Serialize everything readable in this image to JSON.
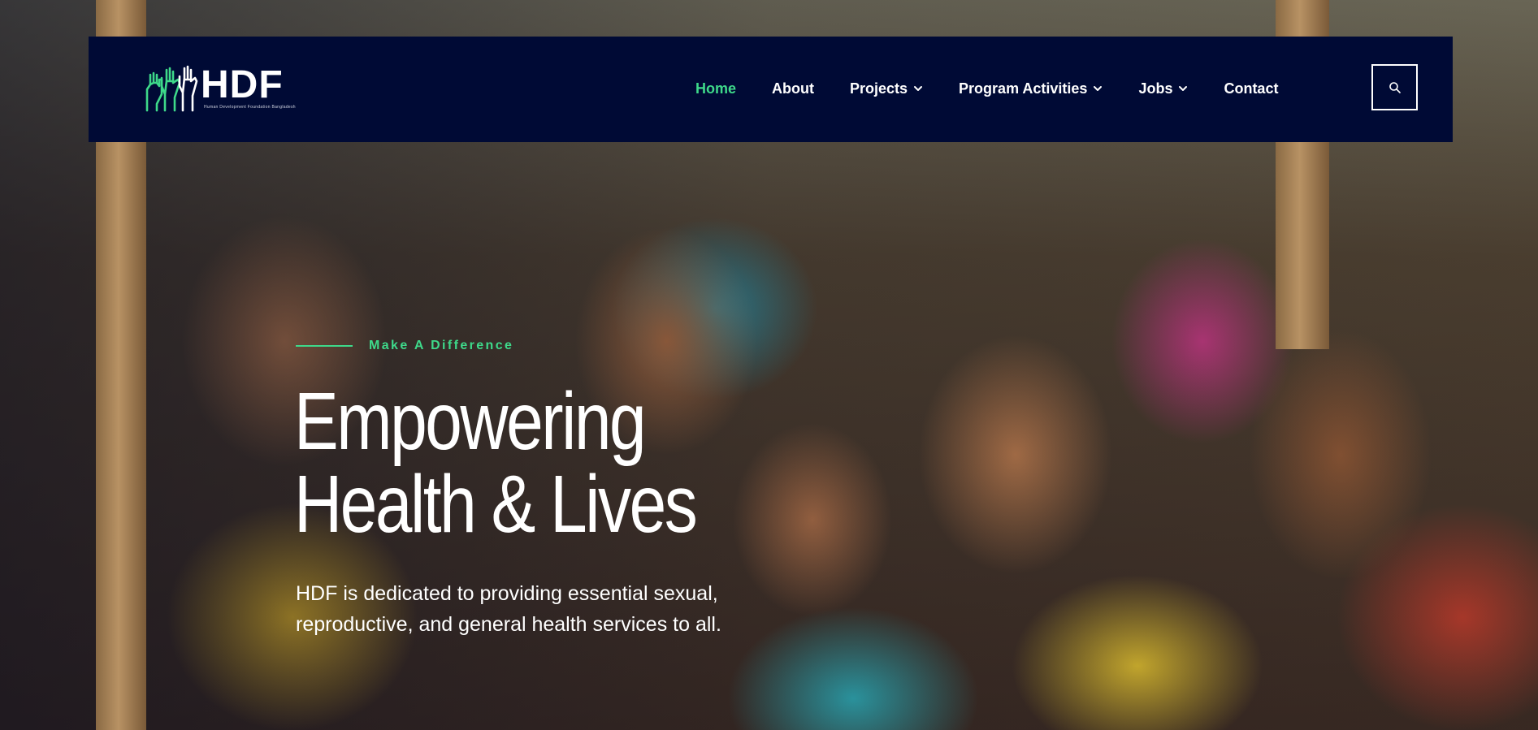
{
  "brand": {
    "name": "HDF",
    "tagline": "Human Development Foundation Bangladesh",
    "logo_icon": "raised-hands-icon",
    "accent_color": "#3ed98a"
  },
  "nav": {
    "background": "#000a35",
    "items": [
      {
        "label": "Home",
        "active": true,
        "dropdown": false
      },
      {
        "label": "About",
        "active": false,
        "dropdown": false
      },
      {
        "label": "Projects",
        "active": false,
        "dropdown": true
      },
      {
        "label": "Program Activities",
        "active": false,
        "dropdown": true
      },
      {
        "label": "Jobs",
        "active": false,
        "dropdown": true
      },
      {
        "label": "Contact",
        "active": false,
        "dropdown": false
      }
    ],
    "search_icon": "search-icon"
  },
  "hero": {
    "eyebrow": "Make A Difference",
    "headline_line1": "Empowering",
    "headline_line2": "Health & Lives",
    "description": "HDF is dedicated to providing essential sexual, reproductive, and general health services to all."
  }
}
